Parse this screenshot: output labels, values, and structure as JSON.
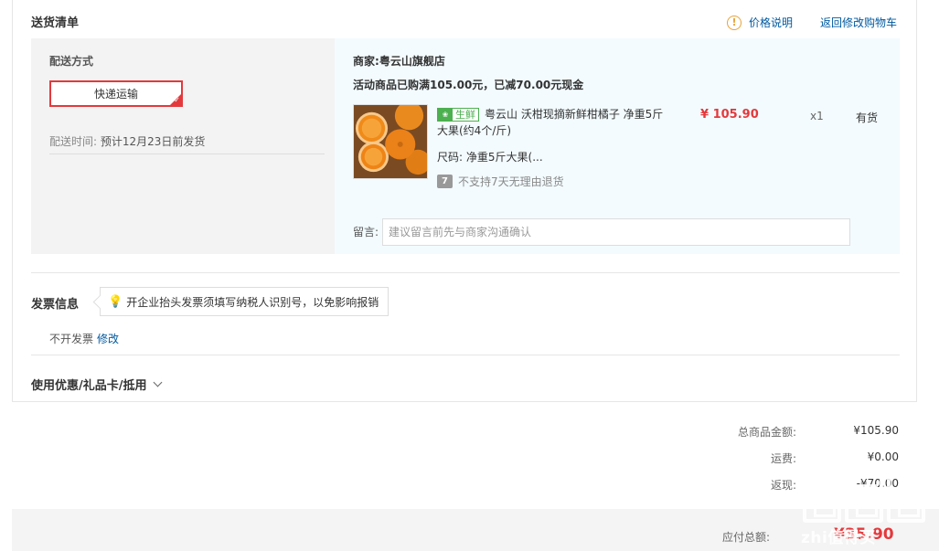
{
  "header": {
    "title": "送货清单",
    "price_note": "价格说明",
    "warn_glyph": "!",
    "back_to_cart": "返回修改购物车"
  },
  "delivery": {
    "method_label": "配送方式",
    "selected_option": "快递运输",
    "time_label": "配送时间:",
    "time_value": "预计12月23日前发货"
  },
  "merchant": {
    "label": "商家:",
    "name": "粤云山旗舰店",
    "promo": "活动商品已购满105.00元，已减70.00元现金"
  },
  "product": {
    "badge": "生鲜",
    "name": "粤云山 沃柑现摘新鲜柑橘子 净重5斤大果(约4个/斤)",
    "price": "¥ 105.90",
    "quantity": "x1",
    "stock": "有货",
    "size_label": "尺码:",
    "size_value": "净重5斤大果(...",
    "return_icon": "7",
    "return_policy": "不支持7天无理由退货"
  },
  "note": {
    "label": "留言:",
    "placeholder": "建议留言前先与商家沟通确认"
  },
  "invoice": {
    "title": "发票信息",
    "tip": "开企业抬头发票须填写纳税人识别号，以免影响报销",
    "status": "不开发票",
    "edit": "修改"
  },
  "coupon": {
    "label": "使用优惠/礼品卡/抵用"
  },
  "summary": {
    "goods_total_label": "总商品金额:",
    "goods_total": "¥105.90",
    "shipping_label": "运费:",
    "shipping": "¥0.00",
    "cashback_label": "返现:",
    "cashback": "-¥70.00"
  },
  "total": {
    "label": "应付总额:",
    "value": "¥35.90"
  },
  "watermark": {
    "text": "zhi值得买"
  },
  "colors": {
    "accent_red": "#e4393c",
    "link_blue": "#005aa0",
    "fresh_green": "#4caf50",
    "warn_orange": "#e8a33a"
  }
}
